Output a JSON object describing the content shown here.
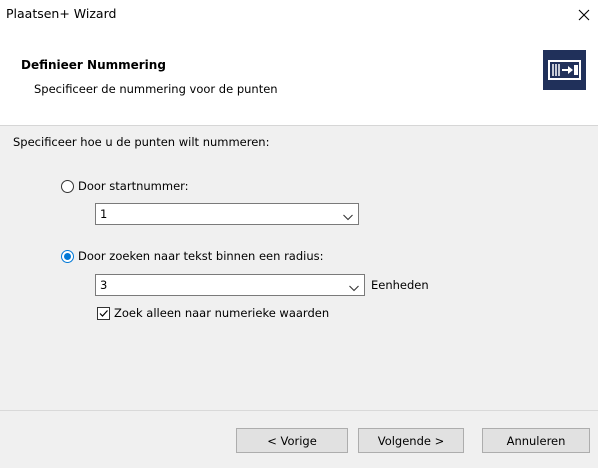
{
  "window": {
    "title": "Plaatsen+ Wizard"
  },
  "header": {
    "title": "Definieer Nummering",
    "subtitle": "Specificeer de nummering voor de punten"
  },
  "main": {
    "prompt": "Specificeer hoe u de punten wilt nummeren:",
    "option_start": {
      "label": "Door startnummer:",
      "selected": false,
      "value": "1"
    },
    "option_search": {
      "label": "Door zoeken naar tekst binnen een radius:",
      "selected": true,
      "value": "3",
      "units_label": "Eenheden"
    },
    "numeric_only": {
      "label": "Zoek alleen naar numerieke waarden",
      "checked": true
    }
  },
  "footer": {
    "back_label": "< Vorige",
    "next_label": "Volgende >",
    "cancel_label": "Annuleren"
  },
  "colors": {
    "accent": "#0078d7",
    "icon_bg": "#20305a",
    "panel_bg": "#f0f0f0"
  }
}
